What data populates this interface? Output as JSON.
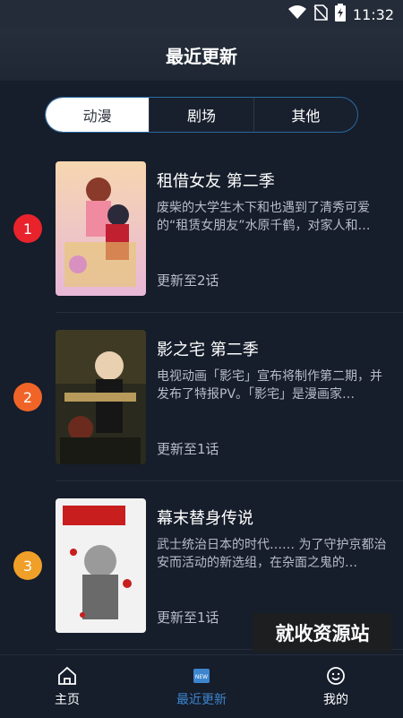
{
  "status_bar": {
    "time": "11:32",
    "icons": [
      "wifi-icon",
      "no-sim-icon",
      "battery-charging-icon"
    ]
  },
  "header": {
    "title": "最近更新"
  },
  "tabs": [
    {
      "label": "动漫",
      "active": true
    },
    {
      "label": "剧场",
      "active": false
    },
    {
      "label": "其他",
      "active": false
    }
  ],
  "items": [
    {
      "rank": "1",
      "rank_color": "#e8232c",
      "title": "租借女友 第二季",
      "desc": "废柴的大学生木下和也遇到了清秀可爱的“租赁女朋友”水原千鹤，对家人和…",
      "update": "更新至2话"
    },
    {
      "rank": "2",
      "rank_color": "#f06428",
      "title": "影之宅  第二季",
      "desc": "电视动画「影宅」宣布将制作第二期，并发布了特报PV。「影宅」是漫画家…",
      "update": "更新至1话"
    },
    {
      "rank": "3",
      "rank_color": "#f0a028",
      "title": "幕末替身传说",
      "desc": "武士统治日本的时代…… 为了守护京都治安而活动的新选组，在杂面之鬼的…",
      "update": "更新至1话"
    }
  ],
  "watermark": "就收资源站",
  "bottom_nav": [
    {
      "label": "主页",
      "icon": "home-icon",
      "active": false
    },
    {
      "label": "最近更新",
      "icon": "new-icon",
      "active": true
    },
    {
      "label": "我的",
      "icon": "smiley-icon",
      "active": false
    }
  ],
  "colors": {
    "accent": "#3d86cf",
    "background": "#161d2b"
  }
}
